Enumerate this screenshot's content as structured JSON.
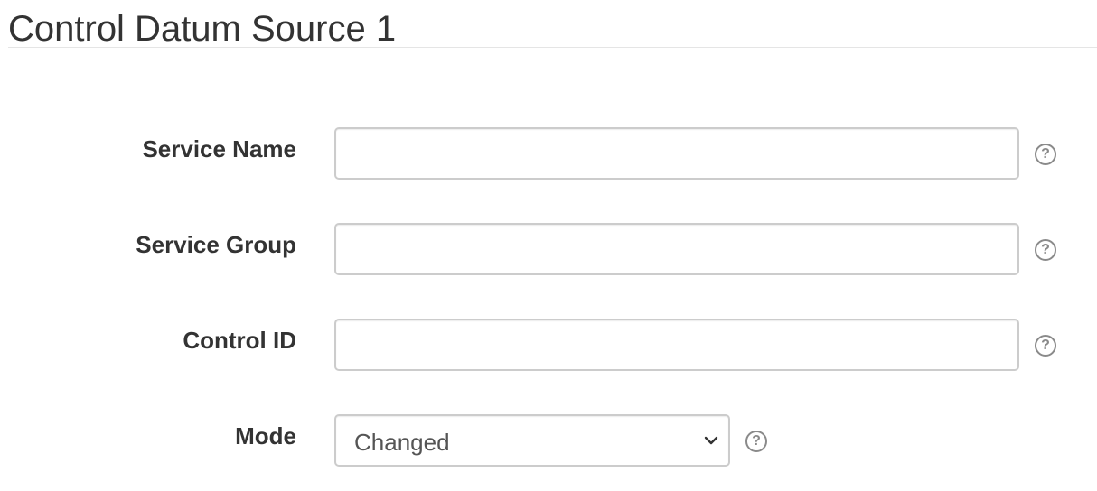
{
  "section": {
    "title": "Control Datum Source 1"
  },
  "form": {
    "service_name": {
      "label": "Service Name",
      "value": "",
      "help_icon": "question-circle-icon"
    },
    "service_group": {
      "label": "Service Group",
      "value": "",
      "help_icon": "question-circle-icon"
    },
    "control_id": {
      "label": "Control ID",
      "value": "",
      "help_icon": "question-circle-icon"
    },
    "mode": {
      "label": "Mode",
      "selected": "Changed",
      "dropdown_icon": "chevron-down-icon",
      "help_icon": "question-circle-icon"
    }
  },
  "colors": {
    "text": "#333333",
    "input_border": "#cccccc",
    "help_icon": "#8a8a8a",
    "rule": "#e5e5e5"
  }
}
